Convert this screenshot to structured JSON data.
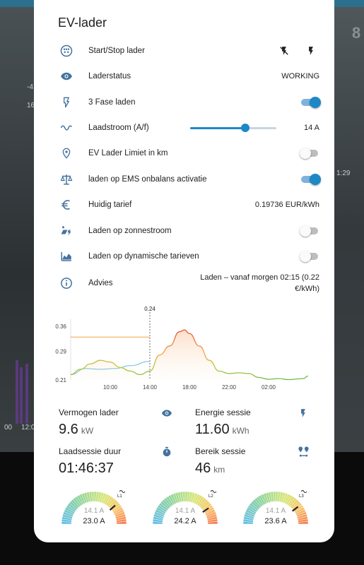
{
  "card": {
    "title": "EV-lader"
  },
  "rows": [
    {
      "label": "Start/Stop lader",
      "icon": "ev-plug-icon"
    },
    {
      "label": "Laderstatus",
      "icon": "eye-icon",
      "value": "WORKING"
    },
    {
      "label": "3 Fase laden",
      "icon": "flash-icon",
      "toggle_on": true
    },
    {
      "label": "Laadstroom (A/f)",
      "icon": "sine-wave-icon",
      "value": "14 A",
      "slider_fraction": 0.64
    },
    {
      "label": "EV Lader Limiet in km",
      "icon": "map-marker-icon",
      "toggle_on": false
    },
    {
      "label": "laden op EMS onbalans activatie",
      "icon": "scale-balance-icon",
      "toggle_on": true
    },
    {
      "label": "Huidig tarief",
      "icon": "euro-icon",
      "value": "0.19736 EUR/kWh"
    },
    {
      "label": "Laden op zonnestroom",
      "icon": "solar-power-icon",
      "toggle_on": false
    },
    {
      "label": "Laden op dynamische tarieven",
      "icon": "chart-area-icon",
      "toggle_on": false
    },
    {
      "label": "Advies",
      "icon": "info-icon",
      "value": "Laden – vanaf morgen 02:15 (0.22 €/kWh)"
    }
  ],
  "chart_data": {
    "type": "line",
    "y_ticks": [
      "0.36",
      "0.29",
      "0.21"
    ],
    "ylim": [
      0.21,
      0.38
    ],
    "x_ticks": [
      "10:00",
      "14:00",
      "18:00",
      "22:00",
      "02:00"
    ],
    "now_label": "0.24",
    "series": [
      {
        "color": "#f5a046",
        "x": [
          6.0,
          14.0
        ],
        "y": [
          0.33,
          0.33
        ]
      },
      {
        "color": "#6db8e0",
        "x": [
          6.0,
          7.5,
          9.0,
          10.5,
          12.0,
          14.0
        ],
        "y": [
          0.225,
          0.242,
          0.24,
          0.242,
          0.25,
          0.262
        ]
      },
      {
        "color": "#8bc34a",
        "x": [
          6.0,
          7.0,
          8.0,
          9.0,
          10.0,
          11.0,
          12.0,
          13.0,
          14.0,
          15.0,
          16.0,
          17.0,
          17.5,
          18.0,
          19.0,
          20.0,
          21.0,
          22.0,
          23.0,
          24.0,
          25.0,
          26.0,
          27.0,
          28.0,
          29.5,
          30.0
        ],
        "y": [
          0.225,
          0.24,
          0.255,
          0.265,
          0.26,
          0.245,
          0.235,
          0.225,
          0.235,
          0.28,
          0.305,
          0.345,
          0.35,
          0.34,
          0.305,
          0.265,
          0.235,
          0.228,
          0.23,
          0.228,
          0.217,
          0.212,
          0.214,
          0.211,
          0.214,
          0.221
        ]
      }
    ]
  },
  "stats": {
    "vermogen": {
      "label": "Vermogen lader",
      "value": "9.6",
      "unit": "kW",
      "icon": "eye-icon"
    },
    "energie": {
      "label": "Energie sessie",
      "value": "11.60",
      "unit": "kWh",
      "icon": "flash-icon"
    },
    "duur": {
      "label": "Laadsessie duur",
      "value": "01:46:37",
      "icon": "timer-icon"
    },
    "bereik": {
      "label": "Bereik sessie",
      "value": "46",
      "unit": "km",
      "icon": "map-marker-path-icon"
    }
  },
  "gauges": [
    {
      "tag": "L1",
      "sub": "14.1 A",
      "value": "23.0 A",
      "fraction": 0.77
    },
    {
      "tag": "L2",
      "sub": "14.1 A",
      "value": "24.2 A",
      "fraction": 0.81
    },
    {
      "tag": "L3",
      "sub": "14.1 A",
      "value": "23.6 A",
      "fraction": 0.79
    }
  ],
  "background": {
    "texts": [
      "1:29",
      "-4",
      "16",
      "8",
      "00",
      "12:0"
    ]
  }
}
